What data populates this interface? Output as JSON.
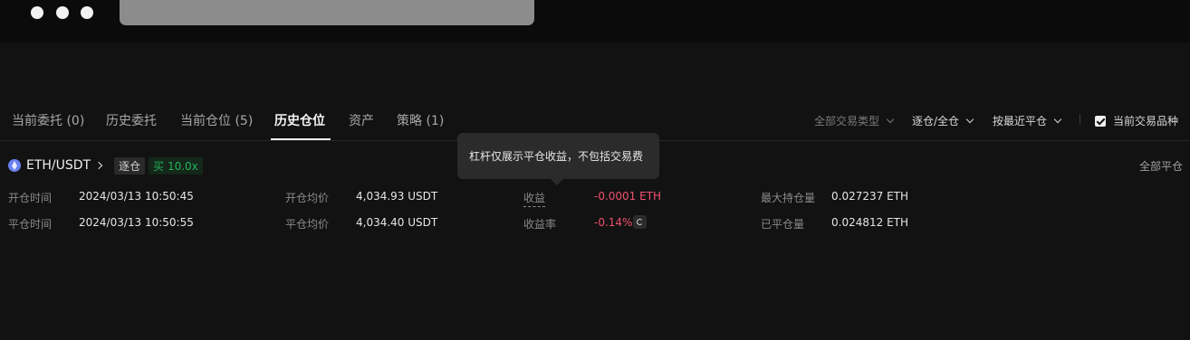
{
  "tabs": [
    {
      "label": "当前委托 (0)"
    },
    {
      "label": "历史委托"
    },
    {
      "label": "当前仓位 (5)"
    },
    {
      "label": "历史仓位"
    },
    {
      "label": "资产"
    },
    {
      "label": "策略 (1)"
    }
  ],
  "active_tab": "历史仓位",
  "filters": {
    "trade_type": "全部交易类型",
    "margin_mode": "逐仓/全仓",
    "sort": "按最近平仓",
    "current_pair_only": "当前交易品种",
    "current_pair_only_checked": true
  },
  "position": {
    "pair": "ETH/USDT",
    "margin_badge": "逐仓",
    "side_leverage": "买 10.0x",
    "close_all": "全部平仓",
    "rows": [
      {
        "time_label": "开仓时间",
        "time_value": "2024/03/13 10:50:45",
        "price_label": "开仓均价",
        "price_value": "4,034.93 USDT",
        "pnl_label": "收益",
        "pnl_value": "-0.0001 ETH",
        "qty_label": "最大持仓量",
        "qty_value": "0.027237 ETH"
      },
      {
        "time_label": "平仓时间",
        "time_value": "2024/03/13 10:50:55",
        "price_label": "平仓均价",
        "price_value": "4,034.40 USDT",
        "pnl_label": "收益率",
        "pnl_value": "-0.14%",
        "qty_label": "已平仓量",
        "qty_value": "0.024812 ETH"
      }
    ]
  },
  "tooltip": "杠杆仅展示平仓收益，不包括交易费",
  "colors": {
    "background": "#121212",
    "negative": "#f0506e",
    "buy_green": "#27b259"
  }
}
